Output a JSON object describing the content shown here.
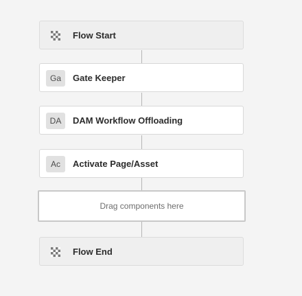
{
  "workflow": {
    "steps": [
      {
        "kind": "flow",
        "icon": "checkered-flag-icon",
        "title": "Flow Start"
      },
      {
        "kind": "step",
        "abbr": "Ga",
        "title": "Gate Keeper"
      },
      {
        "kind": "step",
        "abbr": "DA",
        "title": "DAM Workflow Offloading"
      },
      {
        "kind": "step",
        "abbr": "Ac",
        "title": "Activate Page/Asset"
      }
    ],
    "dropzone_label": "Drag components here",
    "end": {
      "kind": "flow",
      "icon": "checkered-flag-icon",
      "title": "Flow End"
    }
  },
  "colors": {
    "background": "#f4f4f4",
    "node_background": "#ffffff",
    "flow_node_background": "#efefef",
    "connector": "#b5b5b5"
  }
}
